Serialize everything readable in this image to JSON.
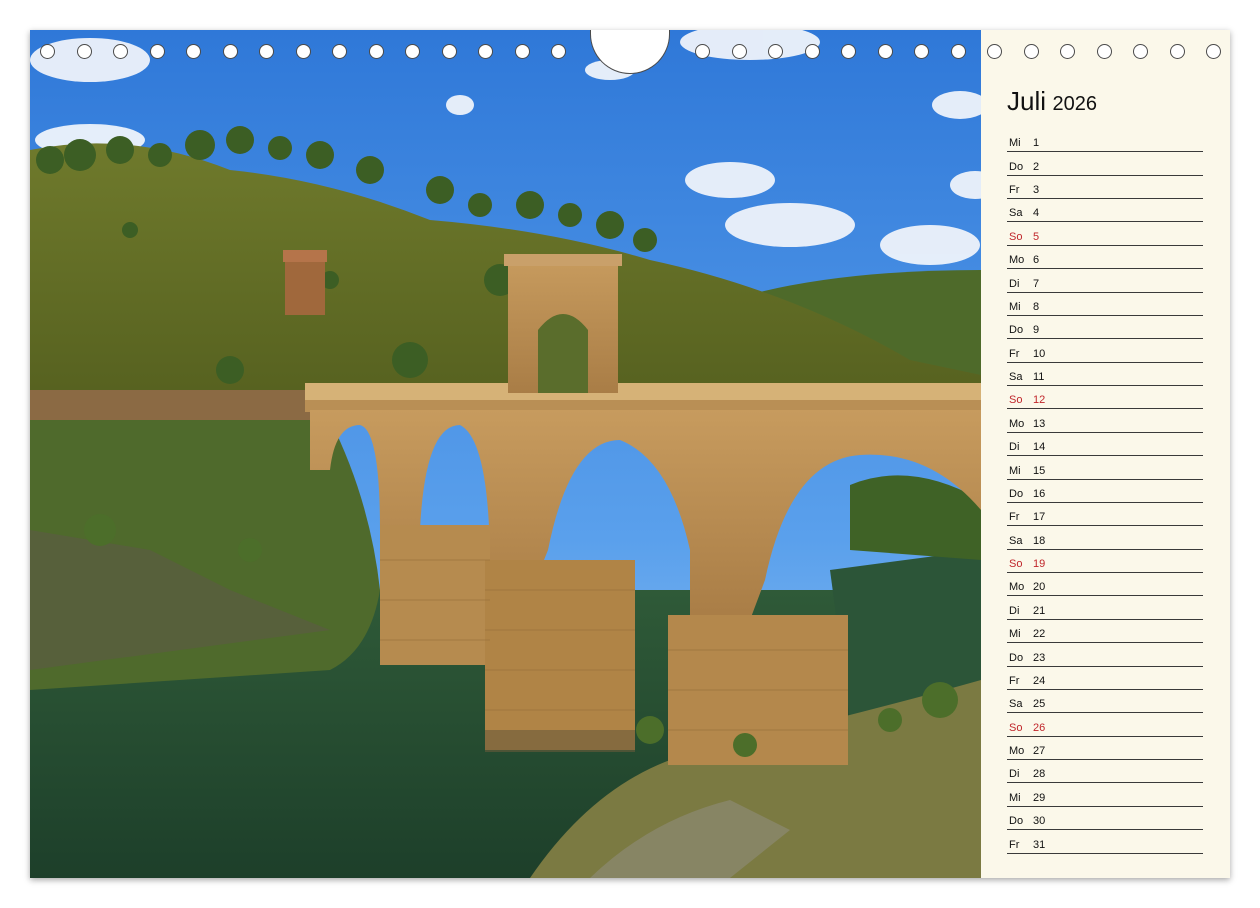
{
  "calendar": {
    "month": "Juli",
    "year": "2026",
    "days": [
      {
        "weekday": "Mi",
        "day": "1",
        "sunday": false
      },
      {
        "weekday": "Do",
        "day": "2",
        "sunday": false
      },
      {
        "weekday": "Fr",
        "day": "3",
        "sunday": false
      },
      {
        "weekday": "Sa",
        "day": "4",
        "sunday": false
      },
      {
        "weekday": "So",
        "day": "5",
        "sunday": true
      },
      {
        "weekday": "Mo",
        "day": "6",
        "sunday": false
      },
      {
        "weekday": "Di",
        "day": "7",
        "sunday": false
      },
      {
        "weekday": "Mi",
        "day": "8",
        "sunday": false
      },
      {
        "weekday": "Do",
        "day": "9",
        "sunday": false
      },
      {
        "weekday": "Fr",
        "day": "10",
        "sunday": false
      },
      {
        "weekday": "Sa",
        "day": "11",
        "sunday": false
      },
      {
        "weekday": "So",
        "day": "12",
        "sunday": true
      },
      {
        "weekday": "Mo",
        "day": "13",
        "sunday": false
      },
      {
        "weekday": "Di",
        "day": "14",
        "sunday": false
      },
      {
        "weekday": "Mi",
        "day": "15",
        "sunday": false
      },
      {
        "weekday": "Do",
        "day": "16",
        "sunday": false
      },
      {
        "weekday": "Fr",
        "day": "17",
        "sunday": false
      },
      {
        "weekday": "Sa",
        "day": "18",
        "sunday": false
      },
      {
        "weekday": "So",
        "day": "19",
        "sunday": true
      },
      {
        "weekday": "Mo",
        "day": "20",
        "sunday": false
      },
      {
        "weekday": "Di",
        "day": "21",
        "sunday": false
      },
      {
        "weekday": "Mi",
        "day": "22",
        "sunday": false
      },
      {
        "weekday": "Do",
        "day": "23",
        "sunday": false
      },
      {
        "weekday": "Fr",
        "day": "24",
        "sunday": false
      },
      {
        "weekday": "Sa",
        "day": "25",
        "sunday": false
      },
      {
        "weekday": "So",
        "day": "26",
        "sunday": true
      },
      {
        "weekday": "Mo",
        "day": "27",
        "sunday": false
      },
      {
        "weekday": "Di",
        "day": "28",
        "sunday": false
      },
      {
        "weekday": "Mi",
        "day": "29",
        "sunday": false
      },
      {
        "weekday": "Do",
        "day": "30",
        "sunday": false
      },
      {
        "weekday": "Fr",
        "day": "31",
        "sunday": false
      }
    ]
  },
  "colors": {
    "panel_background": "#fbf8ea",
    "sunday_text": "#c0262b",
    "rule_line": "#3a3a3a"
  }
}
